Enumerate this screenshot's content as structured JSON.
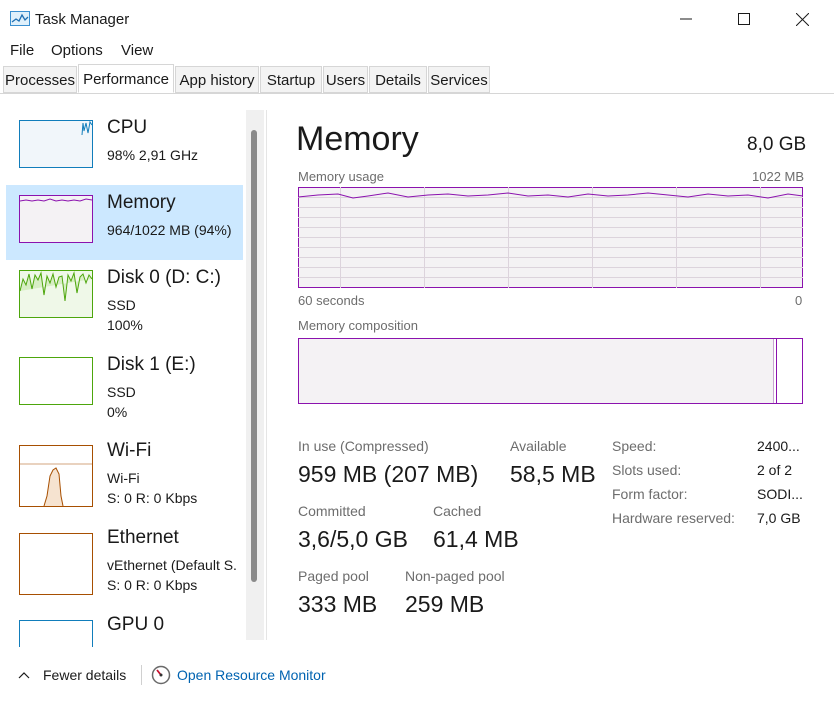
{
  "window": {
    "title": "Task Manager",
    "controls": {
      "minimize": "—",
      "maximize": "☐",
      "close": "✕"
    }
  },
  "menu": [
    "File",
    "Options",
    "View"
  ],
  "tabs": [
    "Processes",
    "Performance",
    "App history",
    "Startup",
    "Users",
    "Details",
    "Services"
  ],
  "active_tab": "Performance",
  "sidebar": {
    "items": [
      {
        "title": "CPU",
        "lines": [
          "98% 2,91 GHz"
        ],
        "color": "#117dbb",
        "selected": false
      },
      {
        "title": "Memory",
        "lines": [
          "964/1022 MB (94%)"
        ],
        "color": "#8b12ae",
        "selected": true
      },
      {
        "title": "Disk 0 (D: C:)",
        "lines": [
          "SSD",
          "100%"
        ],
        "color": "#4da60c",
        "selected": false
      },
      {
        "title": "Disk 1 (E:)",
        "lines": [
          "SSD",
          "0%"
        ],
        "color": "#4da60c",
        "selected": false
      },
      {
        "title": "Wi-Fi",
        "lines": [
          "Wi-Fi",
          "S: 0 R: 0 Kbps"
        ],
        "color": "#a74f01",
        "selected": false
      },
      {
        "title": "Ethernet",
        "lines": [
          "vEthernet (Default S.",
          "S: 0 R: 0 Kbps"
        ],
        "color": "#a74f01",
        "selected": false
      },
      {
        "title": "GPU 0",
        "lines": [],
        "color": "#117dbb",
        "selected": false
      }
    ]
  },
  "main": {
    "title": "Memory",
    "total": "8,0 GB",
    "usage_label": "Memory usage",
    "usage_max": "1022 MB",
    "time_label": "60 seconds",
    "time_end": "0",
    "composition_label": "Memory composition",
    "accent": "#8b12ae",
    "stats": {
      "in_use_label": "In use (Compressed)",
      "in_use_value": "959 MB (207 MB)",
      "available_label": "Available",
      "available_value": "58,5 MB",
      "committed_label": "Committed",
      "committed_value": "3,6/5,0 GB",
      "cached_label": "Cached",
      "cached_value": "61,4 MB",
      "paged_label": "Paged pool",
      "paged_value": "333 MB",
      "nonpaged_label": "Non-paged pool",
      "nonpaged_value": "259 MB"
    },
    "specs": [
      {
        "key": "Speed:",
        "value": "2400..."
      },
      {
        "key": "Slots used:",
        "value": "2 of 2"
      },
      {
        "key": "Form factor:",
        "value": "SODI..."
      },
      {
        "key": "Hardware reserved:",
        "value": "7,0 GB"
      }
    ]
  },
  "footer": {
    "fewer_details": "Fewer details",
    "resource_monitor": "Open Resource Monitor"
  }
}
